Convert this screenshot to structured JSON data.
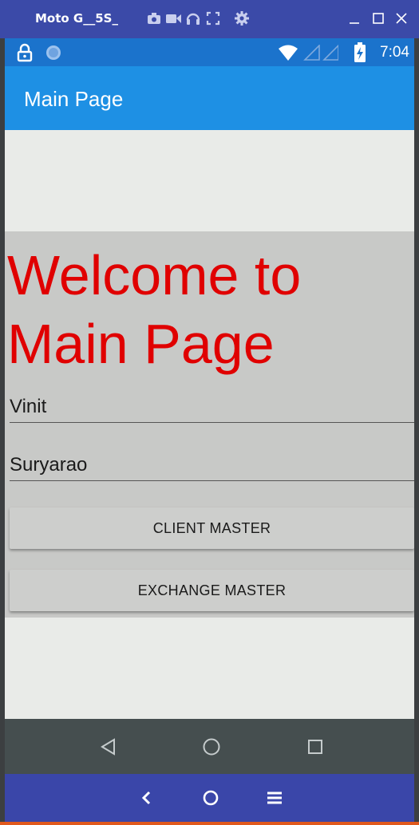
{
  "emulator": {
    "title": "Moto G__5S_",
    "toolbar_icons": [
      "camera-icon",
      "video-icon",
      "headset-icon",
      "fullscreen-icon",
      "settings-icon"
    ],
    "window_icons": [
      "minimize-icon",
      "maximize-icon",
      "close-icon"
    ],
    "bottom_icons": [
      "back-chevron-icon",
      "home-circle-icon",
      "menu-icon"
    ]
  },
  "statusbar": {
    "time": "7:04",
    "icons": [
      "lock-icon",
      "circle-notification-icon",
      "wifi-icon",
      "signal-icon",
      "battery-icon"
    ]
  },
  "appbar": {
    "title": "Main Page"
  },
  "main": {
    "welcome_text": "Welcome to Main Page",
    "first_name_value": "Vinit",
    "last_name_value": "Suryarao",
    "client_master_label": "CLIENT MASTER",
    "exchange_master_label": "EXCHANGE MASTER"
  },
  "android_nav": {
    "icons": [
      "nav-back-icon",
      "nav-home-icon",
      "nav-recents-icon"
    ]
  },
  "colors": {
    "appbar": "#1e90e4",
    "statusbar": "#1b73cc",
    "welcome_text": "#e00000",
    "emulator_frame": "#3b4aa8"
  }
}
